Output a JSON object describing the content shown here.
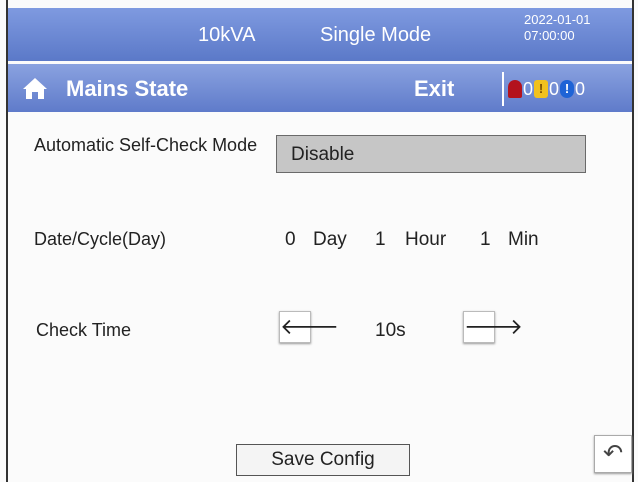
{
  "status": {
    "capacity": "10kVA",
    "mode": "Single Mode",
    "date": "2022-01-01",
    "time": "07:00:00"
  },
  "nav": {
    "title": "Mains State",
    "exit_label": "Exit",
    "alarms": {
      "critical_count": "0",
      "warning_count": "0",
      "info_count": "0"
    },
    "warning_glyph": "!",
    "info_glyph": "!"
  },
  "form": {
    "self_check": {
      "label": "Automatic Self-Check Mode",
      "value": "Disable"
    },
    "cycle": {
      "label": "Date/Cycle(Day)",
      "day_value": "0",
      "day_unit": "Day",
      "hour_value": "1",
      "hour_unit": "Hour",
      "min_value": "1",
      "min_unit": "Min"
    },
    "check_time": {
      "label": "Check Time",
      "value": "10s",
      "left_glyph": "🡐",
      "right_glyph": "🡒"
    }
  },
  "footer": {
    "save_label": "Save Config",
    "back_glyph": "↶"
  },
  "icons": {
    "home": "home-icon",
    "back": "back-icon"
  },
  "colors": {
    "bar_top": "#7f9ae0",
    "bar_bottom": "#5b79c8",
    "select_bg": "#c6c6c6"
  }
}
